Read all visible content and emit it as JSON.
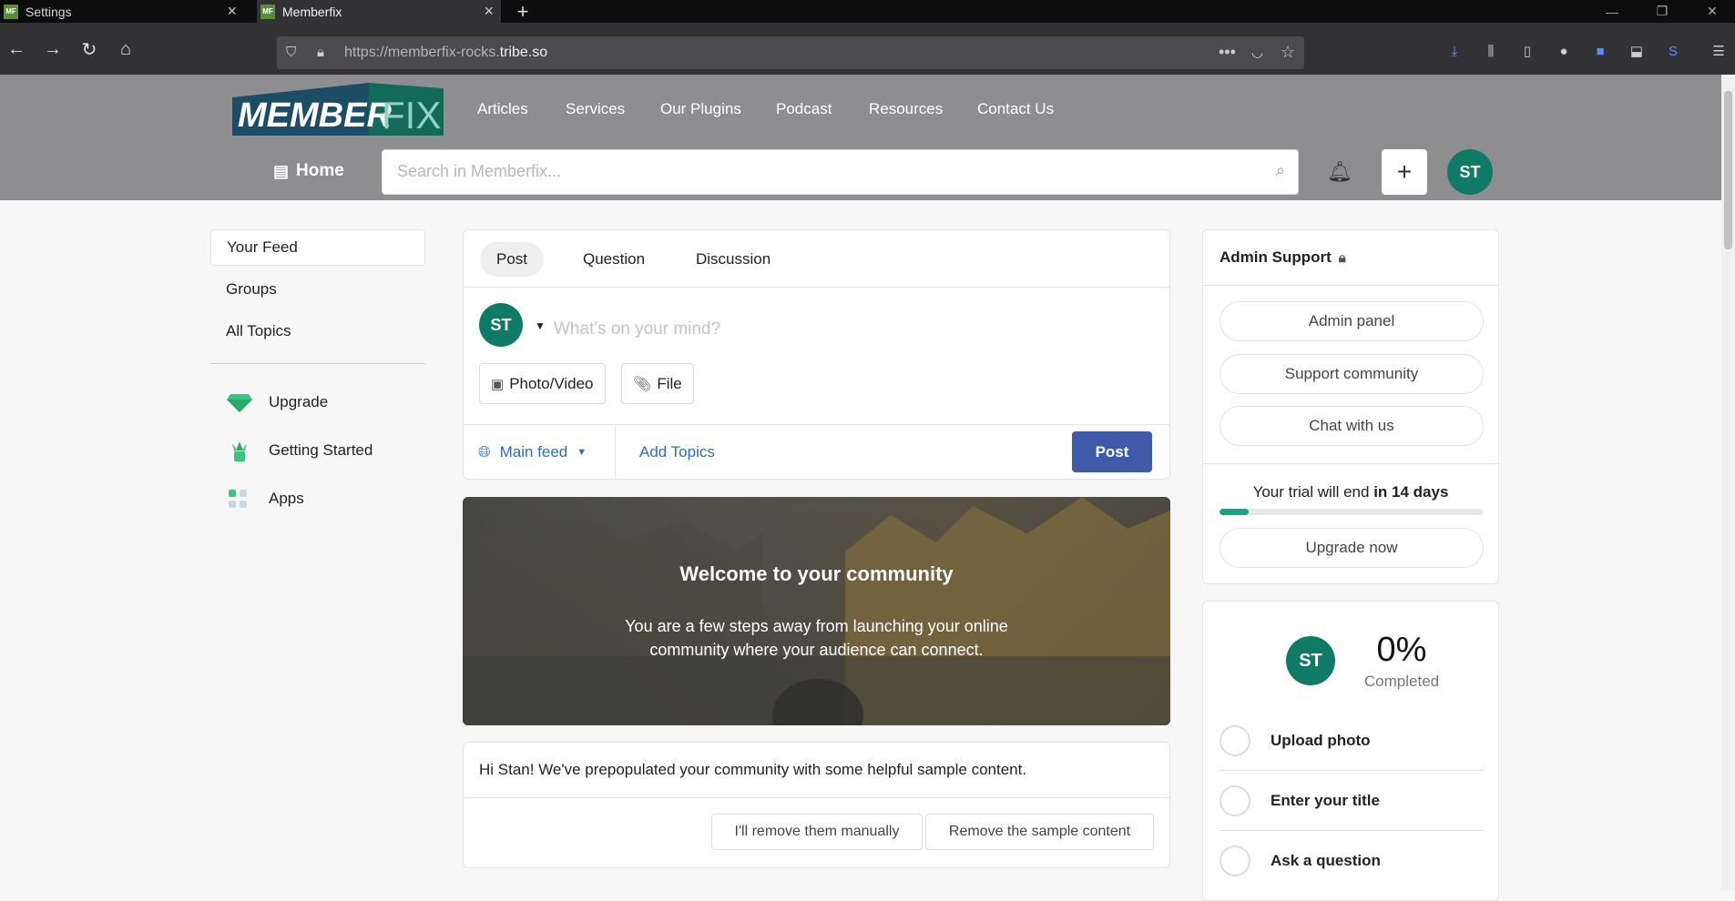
{
  "browser": {
    "tabs": [
      {
        "label": "Settings",
        "favicon": "MF"
      },
      {
        "label": "Memberfix",
        "favicon": "MF"
      }
    ],
    "url_prefix": "https://memberfix-rocks.",
    "url_domain": "tribe.so"
  },
  "site": {
    "logo_text_member": "MEMBER",
    "logo_text_fix": "FIX",
    "nav": [
      "Articles",
      "Services",
      "Our Plugins",
      "Podcast",
      "Resources",
      "Contact Us"
    ],
    "home_label": "Home",
    "search_placeholder": "Search in Memberfix...",
    "user_initials": "ST"
  },
  "sidebar": {
    "items": [
      "Your Feed",
      "Groups",
      "All Topics"
    ],
    "links": [
      "Upgrade",
      "Getting Started",
      "Apps"
    ]
  },
  "composer": {
    "tabs": [
      "Post",
      "Question",
      "Discussion"
    ],
    "placeholder": "What's on your mind?",
    "attach_photo": "Photo/Video",
    "attach_file": "File",
    "feed_label": "Main feed",
    "add_topics": "Add Topics",
    "post_button": "Post"
  },
  "banner": {
    "title": "Welcome to your community",
    "text": "You are a few steps away from launching your online community where your audience can connect."
  },
  "sample": {
    "text": "Hi Stan! We've prepopulated your community with some helpful sample content.",
    "remove_manually": "I'll remove them manually",
    "remove_sample": "Remove the sample content"
  },
  "admin": {
    "title": "Admin Support",
    "buttons": [
      "Admin panel",
      "Support community",
      "Chat with us"
    ],
    "trial_prefix": "Your trial will end ",
    "trial_bold": "in 14 days",
    "trial_progress": 0.11,
    "upgrade_button": "Upgrade now"
  },
  "progress": {
    "percent": "0%",
    "label": "Completed",
    "items": [
      "Upload photo",
      "Enter your title",
      "Ask a question"
    ]
  },
  "colors": {
    "accent_green": "#0f7a66",
    "post_blue": "#3f5aa8",
    "link_blue": "#2d6fb5"
  }
}
